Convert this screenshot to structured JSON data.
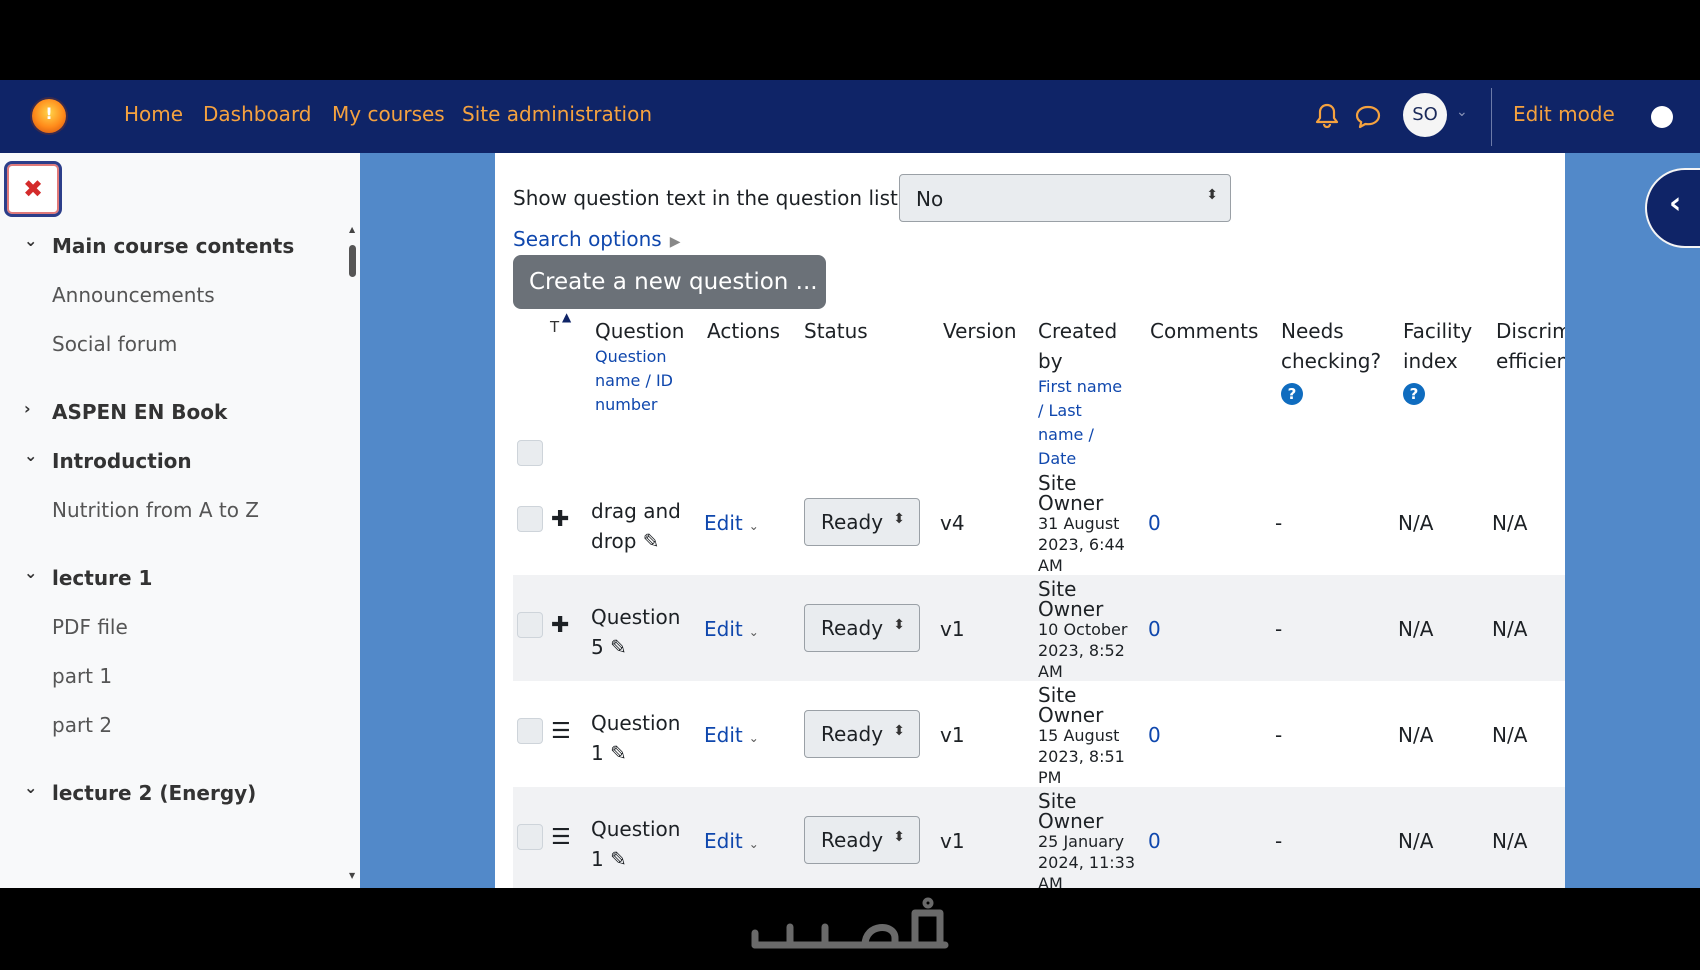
{
  "nav": {
    "links": [
      "Home",
      "Dashboard",
      "My courses",
      "Site administration"
    ],
    "avatar_initials": "SO",
    "edit_mode_label": "Edit mode",
    "icons": [
      "site-logo-icon",
      "bell-icon",
      "chat-bubble-icon",
      "chevron-down-icon"
    ]
  },
  "drawer": {
    "close_glyph": "✖",
    "items": [
      {
        "label": "Main course contents",
        "kind": "section",
        "chevron": "⌄"
      },
      {
        "label": "Announcements",
        "kind": "sub"
      },
      {
        "label": "Social forum",
        "kind": "sub"
      },
      {
        "label": "ASPEN EN Book",
        "kind": "section",
        "chevron": "›"
      },
      {
        "label": "Introduction",
        "kind": "section",
        "chevron": "⌄"
      },
      {
        "label": "Nutrition from A to Z",
        "kind": "sub"
      },
      {
        "label": "lecture 1",
        "kind": "section",
        "chevron": "⌄"
      },
      {
        "label": "PDF file",
        "kind": "sub"
      },
      {
        "label": "part 1",
        "kind": "sub"
      },
      {
        "label": "part 2",
        "kind": "sub"
      },
      {
        "label": "lecture 2 (Energy)",
        "kind": "section",
        "chevron": "⌄"
      }
    ]
  },
  "main": {
    "show_question_text_label": "Show question text in the question list?",
    "show_question_text_value": "No",
    "search_options_label": "Search options",
    "create_button_label": "Create a new question ...",
    "table": {
      "sort_col_label": "T",
      "headers": {
        "question": "Question",
        "question_sub": [
          "Question",
          "name / ID",
          "number"
        ],
        "actions": "Actions",
        "status": "Status",
        "version": "Version",
        "created_by": [
          "Created",
          "by"
        ],
        "created_by_sub": [
          "First name",
          "/ Last",
          "name /",
          "Date"
        ],
        "comments": "Comments",
        "needs_checking": [
          "Needs",
          "checking?"
        ],
        "facility_index": [
          "Facility",
          "index"
        ],
        "discrimination": [
          "Discrim",
          "efficien"
        ]
      },
      "rows": [
        {
          "type_icon": "move-icon",
          "name_lines": [
            "drag and",
            "drop"
          ],
          "action": "Edit",
          "status": "Ready",
          "version": "v4",
          "owner_lines": [
            "Site",
            "Owner"
          ],
          "date_lines": [
            "31 August",
            "2023, 6:44",
            "AM"
          ],
          "comments": "0",
          "needs_checking": "-",
          "facility": "N/A",
          "discrimination": "N/A"
        },
        {
          "type_icon": "move-icon",
          "name_lines": [
            "Question",
            "5"
          ],
          "action": "Edit",
          "status": "Ready",
          "version": "v1",
          "owner_lines": [
            "Site",
            "Owner"
          ],
          "date_lines": [
            "10 October",
            "2023, 8:52",
            "AM"
          ],
          "comments": "0",
          "needs_checking": "-",
          "facility": "N/A",
          "discrimination": "N/A"
        },
        {
          "type_icon": "list-icon",
          "name_lines": [
            "Question",
            "1"
          ],
          "action": "Edit",
          "status": "Ready",
          "version": "v1",
          "owner_lines": [
            "Site",
            "Owner"
          ],
          "date_lines": [
            "15 August",
            "2023, 8:51",
            "PM"
          ],
          "comments": "0",
          "needs_checking": "-",
          "facility": "N/A",
          "discrimination": "N/A"
        },
        {
          "type_icon": "list-icon",
          "name_lines": [
            "Question",
            "1"
          ],
          "action": "Edit",
          "status": "Ready",
          "version": "v1",
          "owner_lines": [
            "Site",
            "Owner"
          ],
          "date_lines": [
            "25 January",
            "2024, 11:33",
            "AM"
          ],
          "comments": "0",
          "needs_checking": "-",
          "facility": "N/A",
          "discrimination": "N/A"
        }
      ]
    }
  },
  "watermark": "خمسات",
  "colors": {
    "navbar": "#0f2467",
    "nav_link": "#f5a23f",
    "page_bg": "#5289c9",
    "link": "#0f47ad",
    "create_button": "#6b7178"
  }
}
